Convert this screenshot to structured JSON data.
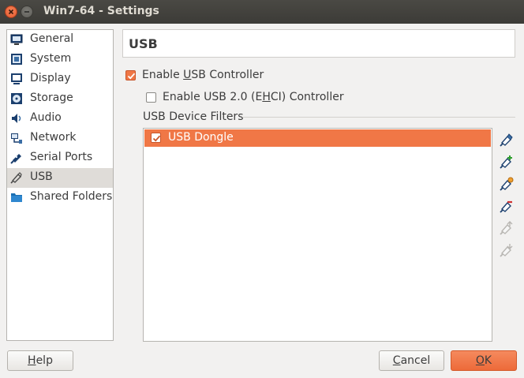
{
  "window": {
    "title": "Win7-64 - Settings"
  },
  "sidebar": {
    "items": [
      {
        "label": "General",
        "icon": "general-icon"
      },
      {
        "label": "System",
        "icon": "system-icon"
      },
      {
        "label": "Display",
        "icon": "display-icon"
      },
      {
        "label": "Storage",
        "icon": "storage-icon"
      },
      {
        "label": "Audio",
        "icon": "audio-icon"
      },
      {
        "label": "Network",
        "icon": "network-icon"
      },
      {
        "label": "Serial Ports",
        "icon": "serial-ports-icon"
      },
      {
        "label": "USB",
        "icon": "usb-icon",
        "selected": true
      },
      {
        "label": "Shared Folders",
        "icon": "shared-folders-icon"
      }
    ]
  },
  "page": {
    "header": "USB",
    "enable_usb": {
      "pre": "Enable ",
      "mnemonic": "U",
      "post": "SB Controller",
      "checked": true
    },
    "enable_usb2": {
      "pre": "Enable USB 2.0 (E",
      "mnemonic": "H",
      "post": "CI) Controller",
      "checked": false
    },
    "filters_group": "USB Device Filters",
    "filters": [
      {
        "label": "USB Dongle",
        "checked": true
      }
    ],
    "tool_buttons": [
      {
        "name": "add-empty-filter-icon",
        "enabled": true
      },
      {
        "name": "add-filter-from-device-icon",
        "enabled": true
      },
      {
        "name": "edit-filter-icon",
        "enabled": true
      },
      {
        "name": "remove-filter-icon",
        "enabled": true
      },
      {
        "name": "move-filter-up-icon",
        "enabled": false
      },
      {
        "name": "move-filter-down-icon",
        "enabled": false
      }
    ]
  },
  "buttons": {
    "help": {
      "mnemonic": "H",
      "rest": "elp"
    },
    "cancel": {
      "mnemonic": "C",
      "rest": "ancel"
    },
    "ok": {
      "mnemonic": "O",
      "rest": "K"
    }
  },
  "colors": {
    "accent": "#f07746",
    "titlebar": "#3c3b37"
  }
}
